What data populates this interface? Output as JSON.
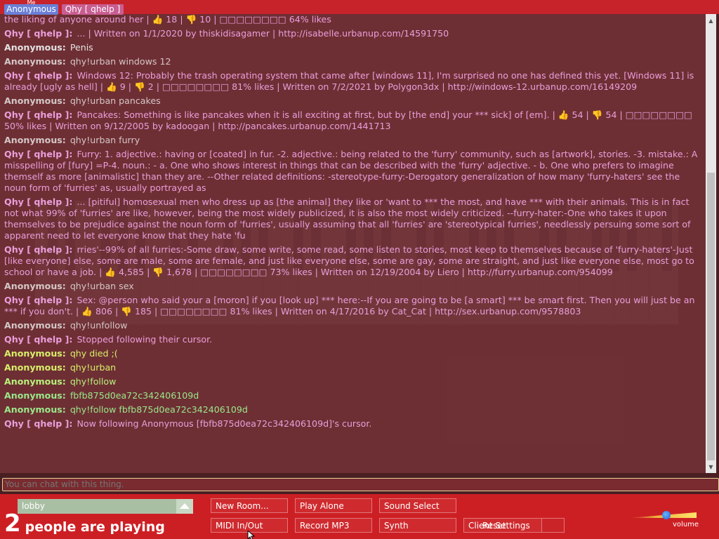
{
  "tabs": {
    "me_tiny": "Me",
    "me": "Anonymous",
    "other": "Qhy [ qhelp ]"
  },
  "chat": [
    {
      "nick": "",
      "color": "#e99fdc",
      "text": "sarcasm. Beware dont talk to her when she is in a bad mood. Oh no watch [a wave] of angry and problems, but only if she really trusts you. Spills tea for the liking of anyone around her | 👍 18 | 👎 10 | □□□□□□□□ 64% likes"
    },
    {
      "nick": "Qhy [ qhelp ]:",
      "color": "#e99fdc",
      "text": "... | Written on 1/1/2020 by thiskidisagamer | http://isabelle.urbanup.com/14591750"
    },
    {
      "nick": "Anonymous:",
      "color": "#e2e2e2",
      "text": "Penis"
    },
    {
      "nick": "Anonymous:",
      "color": "#d4c7c8",
      "text": "qhy!urban windows 12"
    },
    {
      "nick": "Qhy [ qhelp ]:",
      "color": "#e99fdc",
      "text": "Windows 12: Probably the trash operating system that came after [windows 11], I'm surprised no one has defined this yet. [Windows 11] is already [ugly as hell] | 👍 9 | 👎 2 | □□□□□□□□ 81% likes | Written on 7/2/2021 by Polygon3dx | http://windows-12.urbanup.com/16149209"
    },
    {
      "nick": "Anonymous:",
      "color": "#d4c7c8",
      "text": "qhy!urban pancakes"
    },
    {
      "nick": "Qhy [ qhelp ]:",
      "color": "#e99fdc",
      "text": "Pancakes: Something is like pancakes when it is all exciting at first, but by [the end] your *** sick] of [em]. | 👍 54 | 👎 54 | □□□□□□□□ 50% likes | Written on 9/12/2005 by kadoogan | http://pancakes.urbanup.com/1441713"
    },
    {
      "nick": "Anonymous:",
      "color": "#d4c7c8",
      "text": "qhy!urban furry"
    },
    {
      "nick": "Qhy [ qhelp ]:",
      "color": "#e99fdc",
      "text": "Furry: 1. adjective.: having or [coated] in fur. -2. adjective.: being related to the 'furry' community, such as [artwork], stories. -3. mistake.: A misspelling of [fury] =P-4. noun.: - a. One who shows interest in things that can be described with the 'furry' adjective. - b. One who prefers to imagine themself as more [animalistic] than they are. --Other related definitions: -stereotype-furry:-Derogatory generalization of how many 'furry-haters' see the noun form of 'furries' as, usually portrayed as"
    },
    {
      "nick": "Qhy [ qhelp ]:",
      "color": "#e99fdc",
      "text": "... [pitiful] homosexual men who dress up as [the animal] they like or 'want to *** the most, and have *** with their animals. This is in fact not what 99% of 'furries' are like, however, being the most widely publicized, it is also the most widely criticized. --furry-hater:-One who takes it upon themselves to be prejudice against the noun form of 'furries', usually assuming that all 'furries' are 'stereotypical furries', needlessly persuing some sort of apparent need to let everyone know that they hate 'fu"
    },
    {
      "nick": "Qhy [ qhelp ]:",
      "color": "#e99fdc",
      "text": "rries'--99% of all furries:-Some draw, some write, some read, some listen to stories, most keep to themselves because of 'furry-haters'-Just [like everyone] else, some are male, some are female, and just like everyone else, some are gay, some are straight, and just like everyone else, most go to school or have a job. | 👍 4,585 | 👎 1,678 | □□□□□□□□ 73% likes | Written on 12/19/2004 by Liero | http://furry.urbanup.com/954099"
    },
    {
      "nick": "Anonymous:",
      "color": "#d4c7c8",
      "text": "qhy!urban sex"
    },
    {
      "nick": "Qhy [ qhelp ]:",
      "color": "#e99fdc",
      "text": "Sex: @person who said your a [moron] if you [look up] *** here:--If you are going to be [a smart] *** be smart first. Then you will just be an *** if you don't. | 👍 806 | 👎 185 | □□□□□□□□ 81% likes | Written on 4/17/2016 by Cat_Cat | http://sex.urbanup.com/9578803"
    },
    {
      "nick": "Anonymous:",
      "color": "#d4c7c8",
      "text": "qhy!unfollow"
    },
    {
      "nick": "Qhy [ qhelp ]:",
      "color": "#e99fdc",
      "text": "Stopped following their cursor."
    },
    {
      "nick": "Anonymous:",
      "color": "#d8ef6a",
      "text": "qhy died ;("
    },
    {
      "nick": "Anonymous:",
      "color": "#d8ef6a",
      "text": "qhy!urban"
    },
    {
      "nick": "Anonymous:",
      "color": "#b7f27a",
      "text": "qhy!follow"
    },
    {
      "nick": "Anonymous:",
      "color": "#9ae88a",
      "text": "fbfb875d0ea72c342406109d"
    },
    {
      "nick": "Anonymous:",
      "color": "#9ae88a",
      "text": "qhy!follow fbfb875d0ea72c342406109d"
    },
    {
      "nick": "Qhy [ qhelp ]:",
      "color": "#e99fdc",
      "text": "Now following Anonymous [fbfb875d0ea72c342406109d]'s cursor."
    }
  ],
  "chat_input": {
    "placeholder": "You can chat with this thing."
  },
  "room": {
    "name": "lobby"
  },
  "players": {
    "count": "2",
    "label": "people are playing"
  },
  "buttons": {
    "new_room": "New Room...",
    "play_alone": "Play Alone",
    "sound_select": "Sound Select",
    "midi": "MIDI In/Out",
    "record": "Record MP3",
    "synth": "Synth",
    "client_settings": "Client Settings",
    "client_overlay": "Reset"
  },
  "volume": {
    "label": "volume",
    "level": 0.55
  }
}
